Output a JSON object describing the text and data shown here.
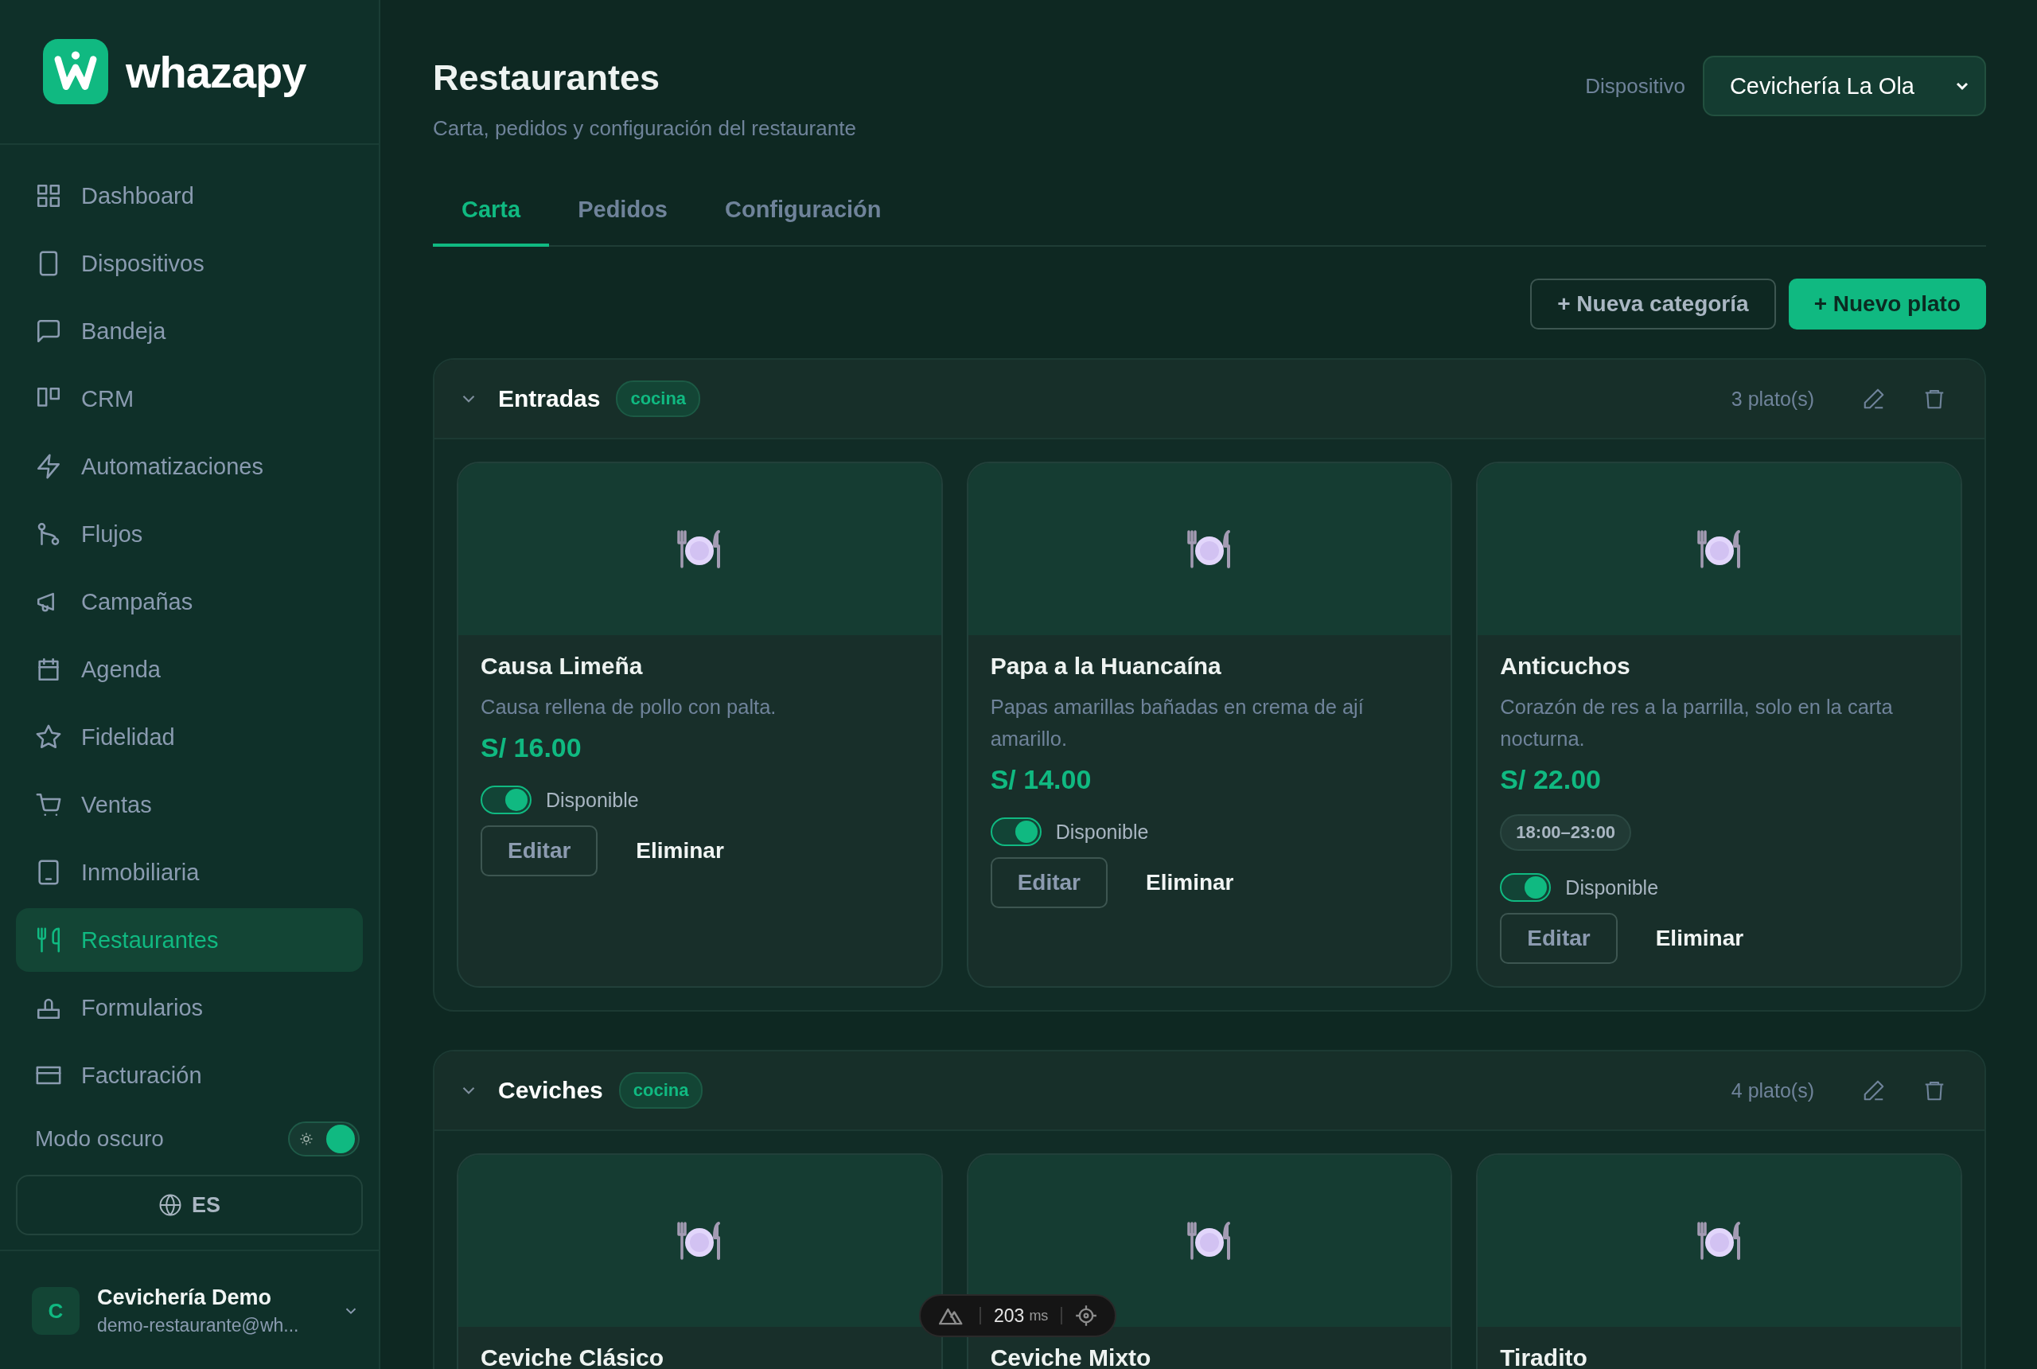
{
  "brand": {
    "name": "whazapy"
  },
  "sidebar": {
    "items": [
      {
        "label": "Dashboard",
        "selected": false
      },
      {
        "label": "Dispositivos",
        "selected": false
      },
      {
        "label": "Bandeja",
        "selected": false
      },
      {
        "label": "CRM",
        "selected": false
      },
      {
        "label": "Automatizaciones",
        "selected": false
      },
      {
        "label": "Flujos",
        "selected": false
      },
      {
        "label": "Campañas",
        "selected": false
      },
      {
        "label": "Agenda",
        "selected": false
      },
      {
        "label": "Fidelidad",
        "selected": false
      },
      {
        "label": "Ventas",
        "selected": false
      },
      {
        "label": "Inmobiliaria",
        "selected": false
      },
      {
        "label": "Restaurantes",
        "selected": true
      },
      {
        "label": "Formularios",
        "selected": false
      },
      {
        "label": "Facturación",
        "selected": false
      }
    ],
    "dark_mode": {
      "label": "Modo oscuro",
      "on": true
    },
    "language": "ES",
    "user": {
      "initial": "C",
      "name": "Cevichería Demo",
      "email": "demo-restaurante@wh..."
    }
  },
  "header": {
    "title": "Restaurantes",
    "subtitle": "Carta, pedidos y configuración del restaurante",
    "device_label": "Dispositivo",
    "device": "Cevichería La Ola"
  },
  "tabs": [
    {
      "label": "Carta",
      "selected": true
    },
    {
      "label": "Pedidos",
      "selected": false
    },
    {
      "label": "Configuración",
      "selected": false
    }
  ],
  "actions": [
    {
      "label": "+ Nueva categoría",
      "kind": "outline"
    },
    {
      "label": "+ Nuevo plato",
      "kind": "primary"
    }
  ],
  "categories": [
    {
      "name": "Entradas",
      "tag": "cocina",
      "count": "3 plato(s)",
      "expanded": true,
      "dishes": [
        {
          "name": "Causa Limeña",
          "description": "Causa rellena de pollo con palta.",
          "price": "S/ 16.00",
          "available": true,
          "availability_label": "Disponible",
          "edit": "Editar",
          "delete": "Eliminar"
        },
        {
          "name": "Papa a la Huancaína",
          "description": "Papas amarillas bañadas en crema de ají amarillo.",
          "price": "S/ 14.00",
          "available": true,
          "availability_label": "Disponible",
          "edit": "Editar",
          "delete": "Eliminar"
        },
        {
          "name": "Anticuchos",
          "description": "Corazón de res a la parrilla, solo en la carta nocturna.",
          "price": "S/ 22.00",
          "hours": "18:00–23:00",
          "available": true,
          "availability_label": "Disponible",
          "edit": "Editar",
          "delete": "Eliminar"
        }
      ]
    },
    {
      "name": "Ceviches",
      "tag": "cocina",
      "count": "4 plato(s)",
      "expanded": true,
      "dishes": [
        {
          "name": "Ceviche Clásico"
        },
        {
          "name": "Ceviche Mixto"
        },
        {
          "name": "Tiradito"
        }
      ]
    }
  ],
  "devtools": {
    "time": "203",
    "unit": "ms"
  }
}
